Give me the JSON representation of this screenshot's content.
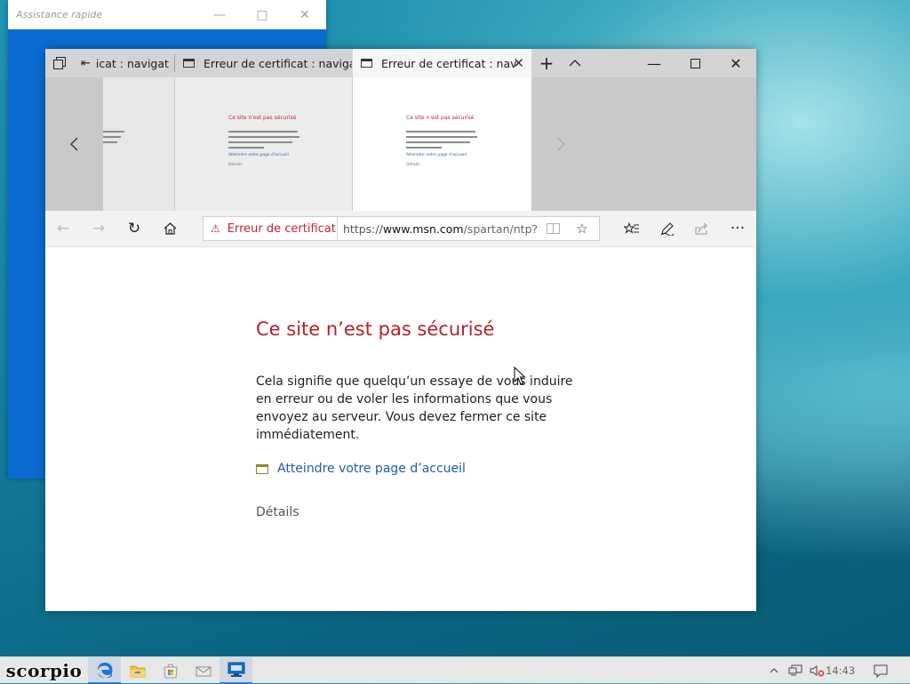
{
  "quick_assist": {
    "title": "Assistance rapide"
  },
  "edge": {
    "tabs": [
      {
        "label": "icat : navigat",
        "active": false
      },
      {
        "label": "Erreur de certificat : navigat",
        "active": false
      },
      {
        "label": "Erreur de certificat : nav",
        "active": true
      }
    ],
    "previews": [
      {
        "heading": "Ce site n'est pas sécurisé",
        "link": "Atteindre votre page d'accueil",
        "details": "Détails"
      },
      {
        "heading": "Ce site n'est pas sécurisé",
        "link": "Atteindre votre page d'accueil",
        "details": "Détails"
      }
    ],
    "address": {
      "cert_label": "Erreur de certificat",
      "url_prefix": "https://",
      "url_domain": "www.msn.com",
      "url_path": "/spartan/ntp?loc"
    },
    "page": {
      "title": "Ce site n’est pas sécurisé",
      "body": "Cela signifie que quelqu’un essaye de vous induire en erreur ou de voler les informations que vous envoyez au serveur. Vous devez fermer ce site immédiatement.",
      "home_link": "Atteindre votre page d’accueil",
      "details": "Détails"
    }
  },
  "taskbar": {
    "brand": "scorpio",
    "time": "14:43"
  },
  "colors": {
    "error_red": "#b5222a",
    "link_blue": "#1f5ea8",
    "taskbar": "#e7e7e7"
  }
}
